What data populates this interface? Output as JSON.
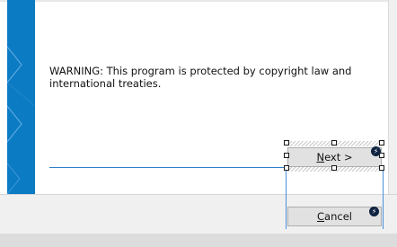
{
  "dialog": {
    "warning_text": "WARNING: This program is protected by copyright law and international treaties."
  },
  "buttons": {
    "next": {
      "mnemonic": "N",
      "rest": "ext >"
    },
    "cancel": {
      "mnemonic": "C",
      "rest": "ancel"
    }
  },
  "icons": {
    "event_badge": "lightning-icon"
  },
  "colors": {
    "banner": "#0b7bc4",
    "separator": "#2f7fc9",
    "badge": "#0e2340"
  }
}
